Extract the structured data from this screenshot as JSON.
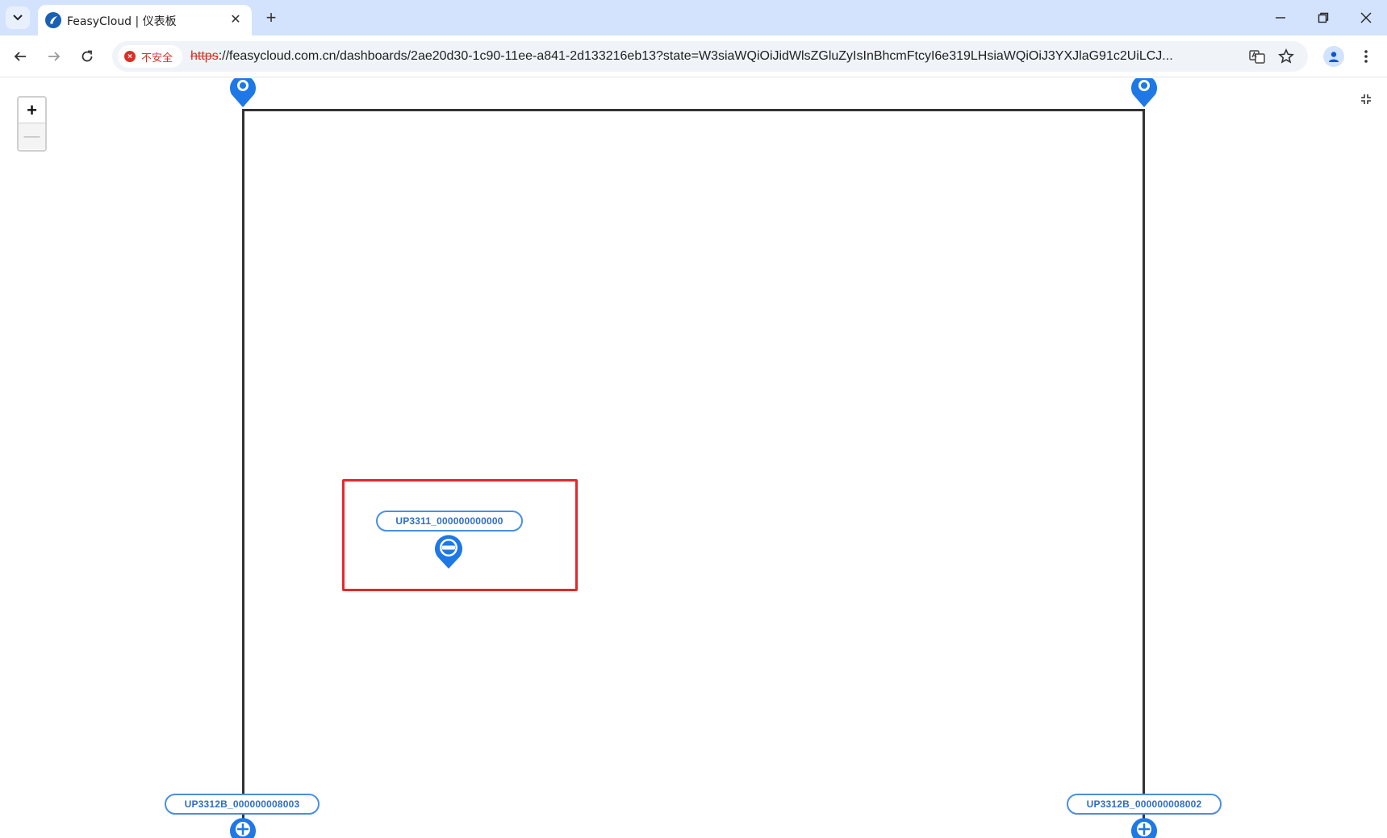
{
  "browser": {
    "tab_title": "FeasyCloud | 仪表板",
    "tab_close": "✕",
    "new_tab": "+",
    "security_label": "不安全",
    "url_scheme": "https",
    "url_rest": "://feasycloud.com.cn/dashboards/2ae20d30-1c90-11ee-a841-2d133216eb13?state=W3siaWQiOiJidWlsZGluZyIsInBhcmFtcyI6e319LHsiaWQiOiJ3YXJlaG91c2UiLCJ...",
    "accent_color": "#d3e3fd"
  },
  "map": {
    "zoom_in": "+",
    "zoom_out": "—",
    "devices": [
      {
        "label": "UP3311_000000000000",
        "icon": "location-pin-icon"
      },
      {
        "label": "UP3312B_000000008003",
        "icon": "location-pin-icon"
      },
      {
        "label": "UP3312B_000000008002",
        "icon": "location-pin-icon"
      }
    ],
    "pin_color": "#1e78e6",
    "highlight_color": "#e8262a"
  }
}
